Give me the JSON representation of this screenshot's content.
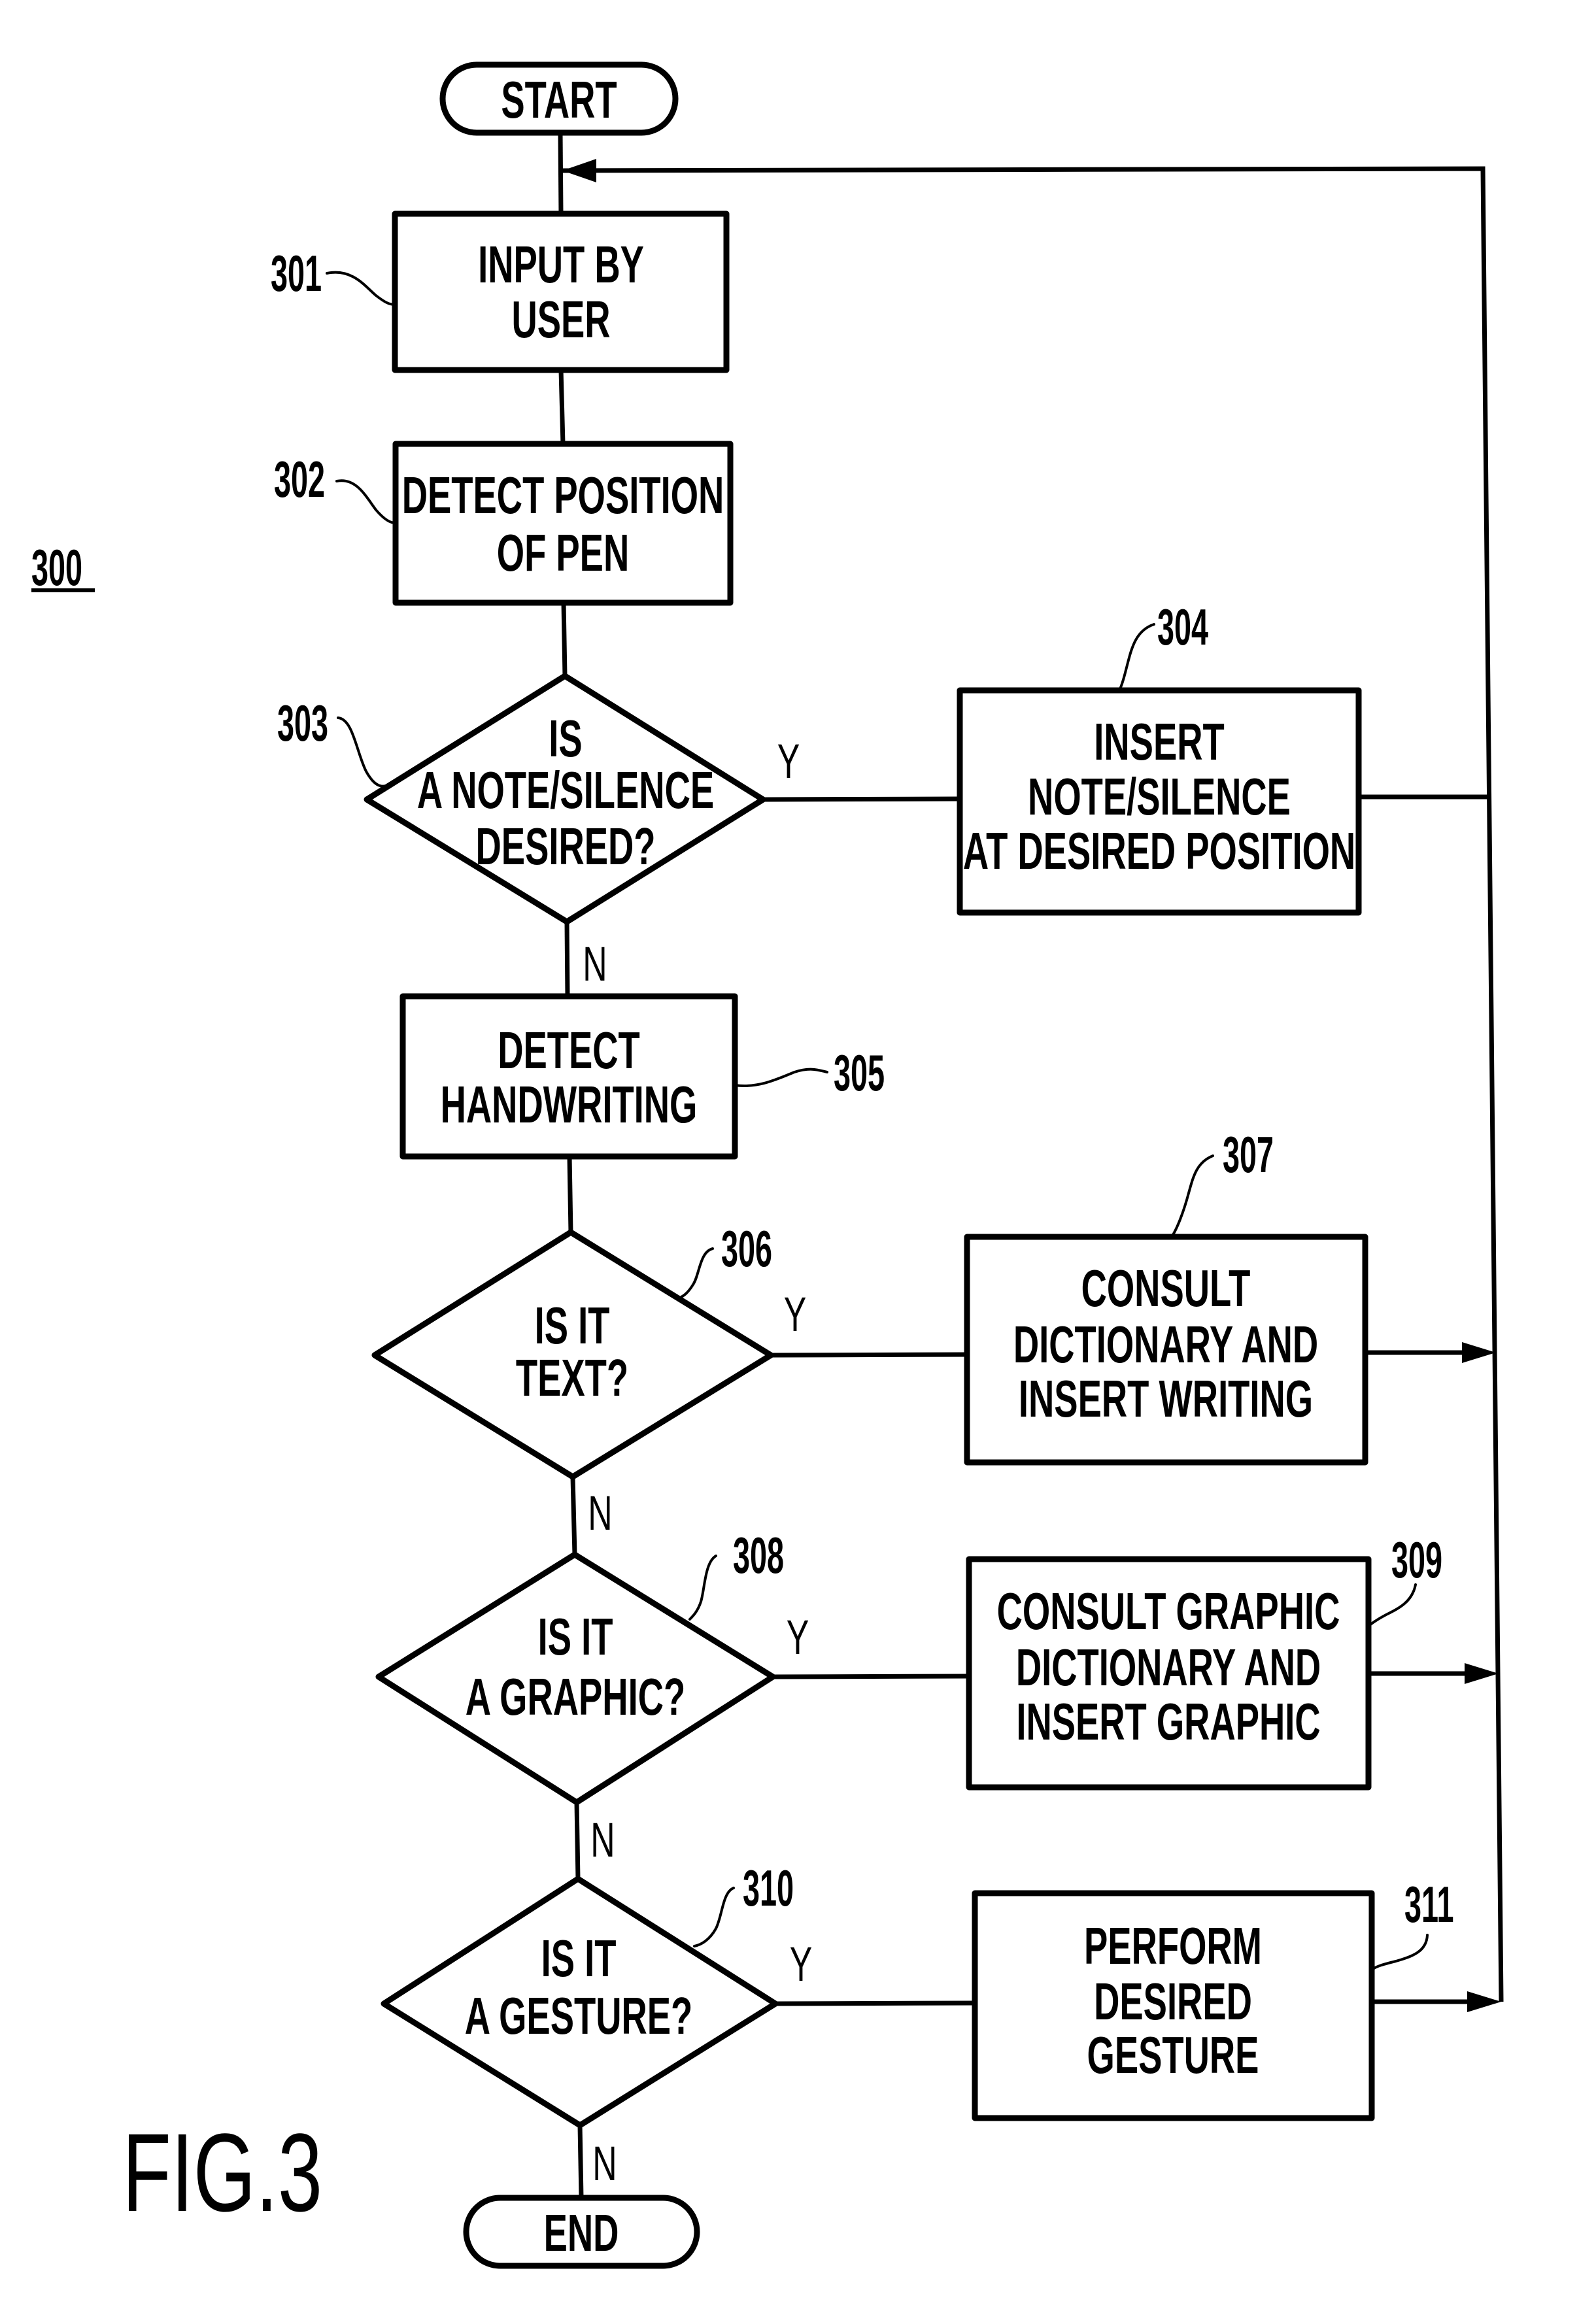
{
  "figure": {
    "label": "FIG.3",
    "reference": "300"
  },
  "terminals": {
    "start": "START",
    "end": "END"
  },
  "steps": {
    "s301": {
      "ref": "301",
      "lines": [
        "INPUT BY",
        "USER"
      ]
    },
    "s302": {
      "ref": "302",
      "lines": [
        "DETECT POSITION",
        "OF PEN"
      ]
    },
    "s303": {
      "ref": "303",
      "lines": [
        "IS",
        "A NOTE/SILENCE",
        "DESIRED?"
      ]
    },
    "s304": {
      "ref": "304",
      "lines": [
        "INSERT",
        "NOTE/SILENCE",
        "AT DESIRED POSITION"
      ]
    },
    "s305": {
      "ref": "305",
      "lines": [
        "DETECT",
        "HANDWRITING"
      ]
    },
    "s306": {
      "ref": "306",
      "lines": [
        "IS IT",
        "TEXT?"
      ]
    },
    "s307": {
      "ref": "307",
      "lines": [
        "CONSULT",
        "DICTIONARY AND",
        "INSERT WRITING"
      ]
    },
    "s308": {
      "ref": "308",
      "lines": [
        "IS IT",
        "A GRAPHIC?"
      ]
    },
    "s309": {
      "ref": "309",
      "lines": [
        "CONSULT GRAPHIC",
        "DICTIONARY AND",
        "INSERT GRAPHIC"
      ]
    },
    "s310": {
      "ref": "310",
      "lines": [
        "IS IT",
        "A GESTURE?"
      ]
    },
    "s311": {
      "ref": "311",
      "lines": [
        "PERFORM",
        "DESIRED",
        "GESTURE"
      ]
    }
  },
  "branch_labels": {
    "yes": "Y",
    "no": "N"
  }
}
